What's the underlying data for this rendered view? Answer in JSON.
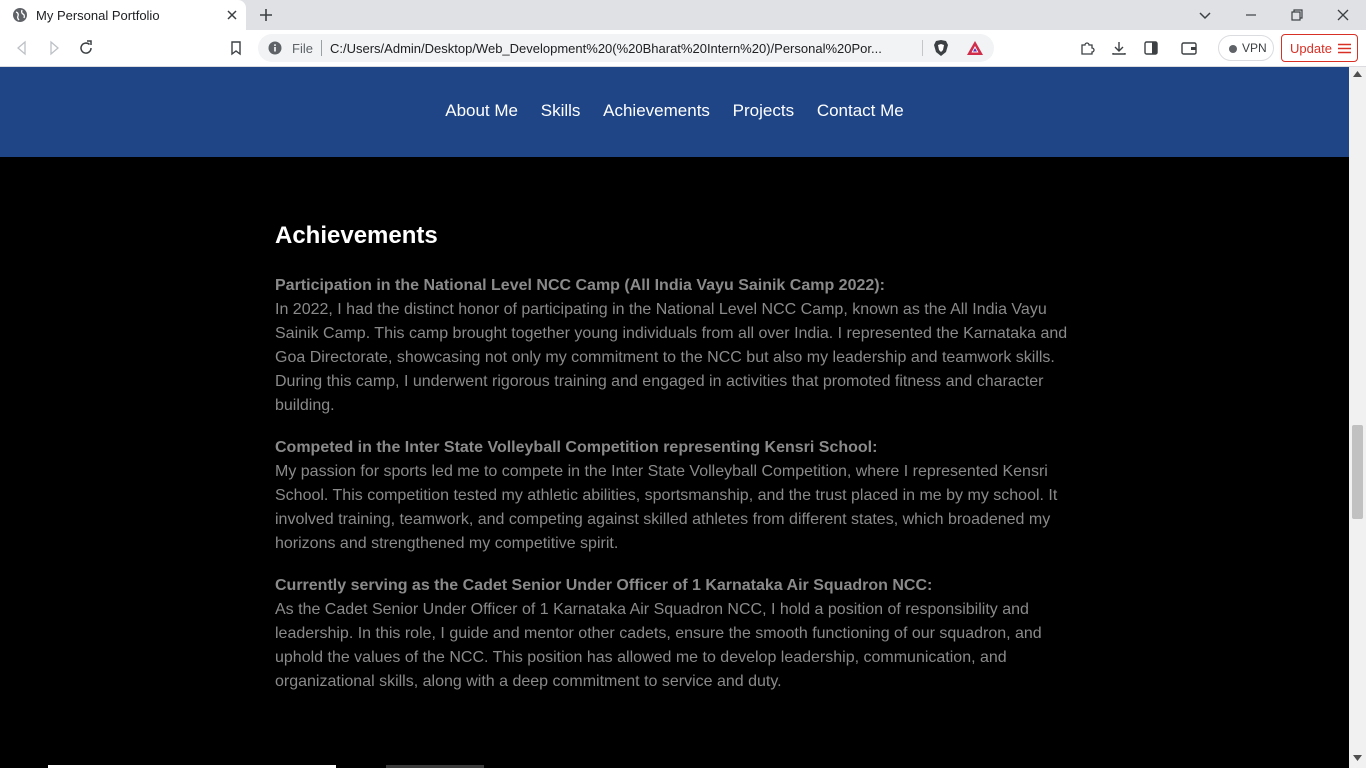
{
  "browser": {
    "tab_title": "My Personal Portfolio",
    "url_scheme": "File",
    "url": "C:/Users/Admin/Desktop/Web_Development%20(%20Bharat%20Intern%20)/Personal%20Por...",
    "vpn_label": "VPN",
    "update_label": "Update"
  },
  "nav": {
    "items": [
      "About Me",
      "Skills",
      "Achievements",
      "Projects",
      "Contact Me"
    ]
  },
  "achievements": {
    "heading": "Achievements",
    "items": [
      {
        "title": "Participation in the National Level NCC Camp (All India Vayu Sainik Camp 2022):",
        "body": "In 2022, I had the distinct honor of participating in the National Level NCC Camp, known as the All India Vayu Sainik Camp. This camp brought together young individuals from all over India. I represented the Karnataka and Goa Directorate, showcasing not only my commitment to the NCC but also my leadership and teamwork skills. During this camp, I underwent rigorous training and engaged in activities that promoted fitness and character building."
      },
      {
        "title": "Competed in the Inter State Volleyball Competition representing Kensri School:",
        "body": "My passion for sports led me to compete in the Inter State Volleyball Competition, where I represented Kensri School. This competition tested my athletic abilities, sportsmanship, and the trust placed in me by my school. It involved training, teamwork, and competing against skilled athletes from different states, which broadened my horizons and strengthened my competitive spirit."
      },
      {
        "title": "Currently serving as the Cadet Senior Under Officer of 1 Karnataka Air Squadron NCC:",
        "body": "As the Cadet Senior Under Officer of 1 Karnataka Air Squadron NCC, I hold a position of responsibility and leadership. In this role, I guide and mentor other cadets, ensure the smooth functioning of our squadron, and uphold the values of the NCC. This position has allowed me to develop leadership, communication, and organizational skills, along with a deep commitment to service and duty."
      }
    ]
  },
  "colors": {
    "nav_bg": "#1f4587",
    "page_bg": "#000000",
    "text_muted": "#8a8a8a",
    "heading": "#ffffff",
    "update_accent": "#d93025"
  }
}
